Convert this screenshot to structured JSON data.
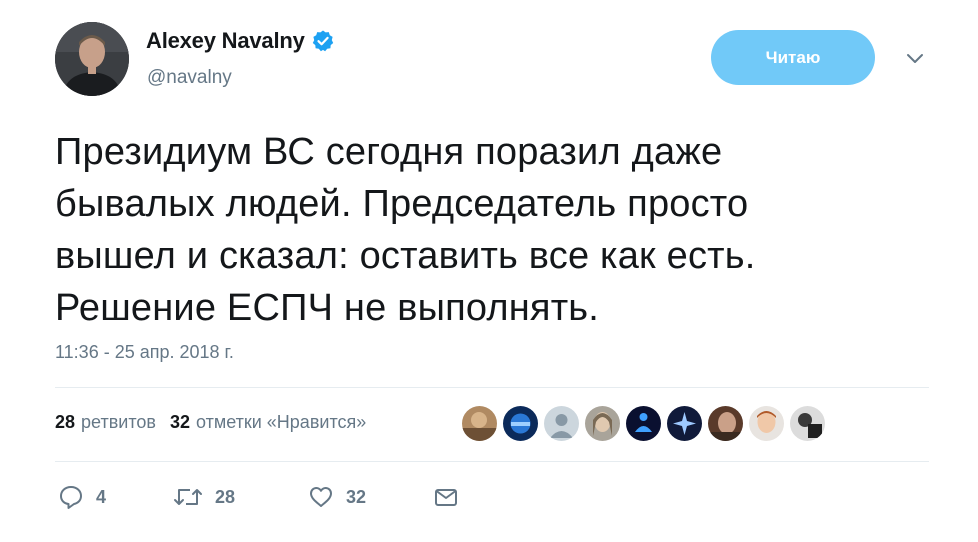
{
  "author": {
    "name": "Alexey Navalny",
    "handle": "@navalny",
    "verified": true
  },
  "follow_button": {
    "label": "Читаю",
    "color": "#71c9f8"
  },
  "tweet": {
    "text": "Президиум ВС сегодня поразил даже\nбывалых людей. Председатель просто\nвышел и сказал: оставить все как есть.\nРешение ЕСПЧ не выполнять.",
    "timestamp": "11:36 - 25 апр. 2018 г."
  },
  "stats": {
    "retweets_count": "28",
    "retweets_label": "ретвитов",
    "likes_count": "32",
    "likes_label": "отметки «Нравится»"
  },
  "liker_faces": [
    {
      "icon": "avatar-face"
    },
    {
      "icon": "avatar-blue-logo"
    },
    {
      "icon": "avatar-default"
    },
    {
      "icon": "avatar-face"
    },
    {
      "icon": "avatar-meditation"
    },
    {
      "icon": "avatar-star"
    },
    {
      "icon": "avatar-face"
    },
    {
      "icon": "avatar-face"
    },
    {
      "icon": "avatar-face"
    }
  ],
  "actions": {
    "reply_count": "4",
    "retweet_count": "28",
    "like_count": "32"
  },
  "colors": {
    "accent": "#1da1f2",
    "secondary_text": "#657786",
    "divider": "#e6ecf0"
  }
}
